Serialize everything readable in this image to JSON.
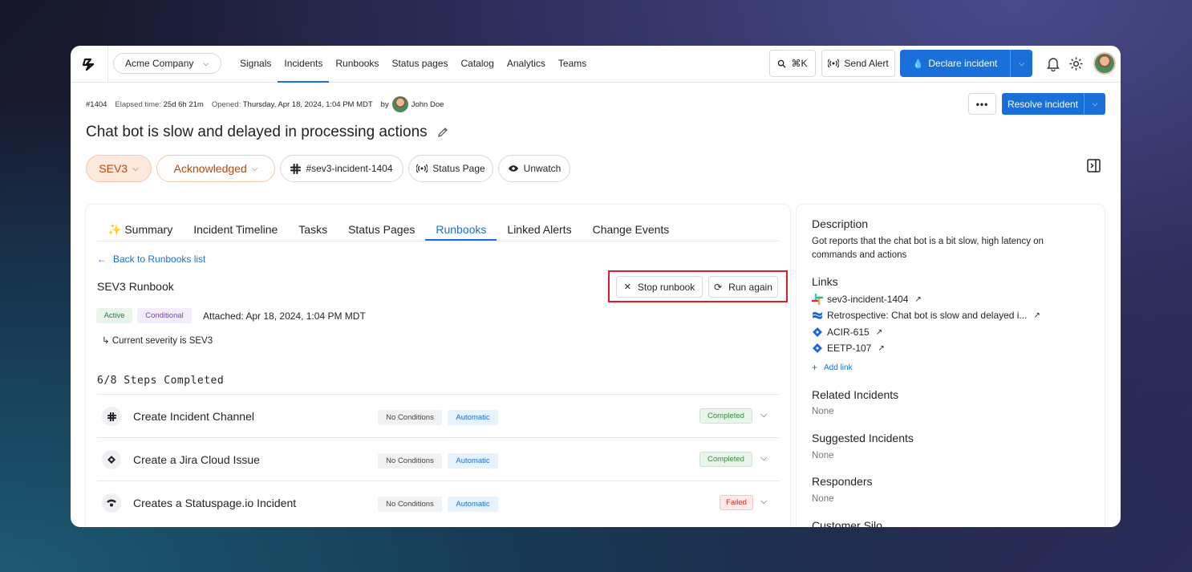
{
  "colors": {
    "accent": "#1a6fd9",
    "severity_bg": "#fde9dc",
    "severity_text": "#b34a0f",
    "completed": "#3b8a3e",
    "failed": "#d12a2a"
  },
  "org": {
    "name": "Acme Company"
  },
  "nav": {
    "items": [
      "Signals",
      "Incidents",
      "Runbooks",
      "Status pages",
      "Catalog",
      "Analytics",
      "Teams"
    ],
    "active": "Incidents"
  },
  "toolbar": {
    "shortcut": "⌘K",
    "send_alert": "Send Alert",
    "declare": "Declare incident"
  },
  "incident": {
    "id": "#1404",
    "elapsed_label": "Elapsed time:",
    "elapsed": "25d 6h 21m",
    "opened_label": "Opened:",
    "opened": "Thursday, Apr 18, 2024, 1:04 PM MDT",
    "by_label": "by",
    "by": "John Doe",
    "title": "Chat bot is slow and delayed in processing actions",
    "resolve": "Resolve incident"
  },
  "pills": {
    "severity": "SEV3",
    "status": "Acknowledged",
    "channel": "#sev3-incident-1404",
    "status_page": "Status Page",
    "watch": "Unwatch"
  },
  "tabs": [
    "✨ Summary",
    "Incident Timeline",
    "Tasks",
    "Status Pages",
    "Runbooks",
    "Linked Alerts",
    "Change Events"
  ],
  "runbook": {
    "back": "Back to Runbooks list",
    "name": "SEV3 Runbook",
    "stop": "Stop runbook",
    "run_again": "Run again",
    "badge_active": "Active",
    "badge_conditional": "Conditional",
    "attached": "Attached: Apr 18, 2024, 1:04 PM MDT",
    "condition": "↳ Current severity is SEV3",
    "steps_completed": "6/8 Steps Completed",
    "steps": [
      {
        "name": "Create Incident Channel",
        "conditions": "No Conditions",
        "mode": "Automatic",
        "status": "Completed",
        "icon": "slack-icon"
      },
      {
        "name": "Create a Jira Cloud Issue",
        "conditions": "No Conditions",
        "mode": "Automatic",
        "status": "Completed",
        "icon": "jira-icon"
      },
      {
        "name": "Creates a Statuspage.io Incident",
        "conditions": "No Conditions",
        "mode": "Automatic",
        "status": "Failed",
        "icon": "statuspage-icon"
      }
    ]
  },
  "sidebar": {
    "description_title": "Description",
    "description": "Got reports that the chat bot is a bit slow, high latency on commands and actions",
    "links_title": "Links",
    "links": [
      {
        "label": "sev3-incident-1404",
        "icon": "slack-icon"
      },
      {
        "label": "Retrospective: Chat bot is slow and delayed i...",
        "icon": "confluence-icon"
      },
      {
        "label": "ACIR-615",
        "icon": "jira-icon"
      },
      {
        "label": "EETP-107",
        "icon": "jira-icon"
      }
    ],
    "add_link": "Add link",
    "related_title": "Related Incidents",
    "related": "None",
    "suggested_title": "Suggested Incidents",
    "suggested": "None",
    "responders_title": "Responders",
    "responders": "None",
    "customer_silo_title": "Customer Silo"
  }
}
